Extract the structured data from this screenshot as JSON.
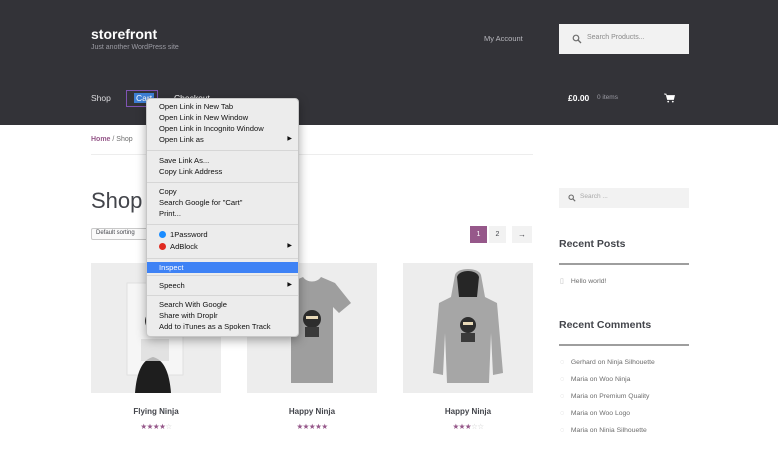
{
  "site": {
    "title": "storefront",
    "description": "Just another WordPress site",
    "my_account": "My Account",
    "search_placeholder": "Search Products..."
  },
  "nav": {
    "shop": "Shop",
    "cart": "Cart",
    "checkout": "Checkout"
  },
  "minicart": {
    "amount": "£0.00",
    "items": "0 items"
  },
  "breadcrumb": {
    "home": "Home",
    "separator": " / ",
    "current": "Shop"
  },
  "page_title": "Shop",
  "sorting": "Default sorting",
  "pagination": {
    "page1": "1",
    "page2": "2",
    "next": "→"
  },
  "products": [
    {
      "name": "Flying Ninja",
      "stars_filled": "★★★★",
      "stars_empty": "☆",
      "rating": 4
    },
    {
      "name": "Happy Ninja",
      "stars_filled": "★★★★★",
      "stars_empty": "",
      "rating": 5
    },
    {
      "name": "Happy Ninja",
      "stars_filled": "★★★",
      "stars_empty": "☆☆",
      "rating": 3
    }
  ],
  "sidebar": {
    "search_placeholder": "Search ...",
    "recent_posts_title": "Recent Posts",
    "recent_posts": [
      "Hello world!"
    ],
    "recent_comments_title": "Recent Comments",
    "recent_comments": [
      "Gerhard on Ninja Silhouette",
      "Maria on Woo Ninja",
      "Maria on Premium Quality",
      "Maria on Woo Logo",
      "Maria on Ninja Silhouette"
    ]
  },
  "context_menu": {
    "open_new_tab": "Open Link in New Tab",
    "open_new_window": "Open Link in New Window",
    "open_incognito": "Open Link in Incognito Window",
    "open_link_as": "Open Link as",
    "save_link_as": "Save Link As...",
    "copy_link_address": "Copy Link Address",
    "copy": "Copy",
    "search_google": "Search Google for \"Cart\"",
    "print": "Print...",
    "onepassword": "1Password",
    "adblock": "AdBlock",
    "inspect": "Inspect",
    "speech": "Speech",
    "search_with_google": "Search With Google",
    "share_droplr": "Share with Droplr",
    "add_itunes": "Add to iTunes as a Spoken Track"
  },
  "colors": {
    "header_bg": "#333338",
    "accent": "#96588a",
    "menu_highlight": "#3e82f5",
    "onepassword_blue": "#1a8cff",
    "adblock_red": "#e02a20"
  },
  "icons": {
    "search": "search-icon",
    "cart": "cart-icon",
    "post": "document-icon",
    "comment": "comment-icon",
    "submenu": "chevron-right-icon"
  }
}
